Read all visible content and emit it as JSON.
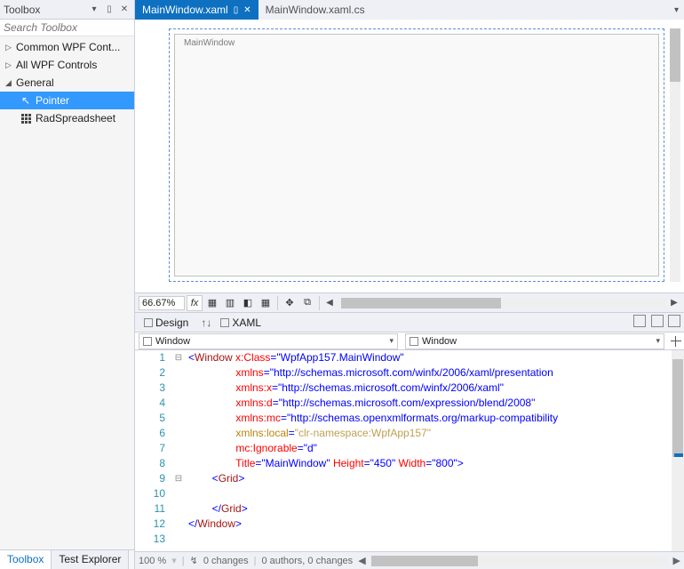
{
  "sidebar": {
    "title": "Toolbox",
    "search_placeholder": "Search Toolbox",
    "groups": {
      "g0": {
        "label": "Common WPF Cont..."
      },
      "g1": {
        "label": "All WPF Controls"
      },
      "g2": {
        "label": "General"
      }
    },
    "tools": {
      "pointer": "Pointer",
      "radspread": "RadSpreadsheet"
    },
    "tabs": {
      "toolbox": "Toolbox",
      "test_explorer": "Test Explorer"
    }
  },
  "tabs": {
    "active": "MainWindow.xaml",
    "inactive": "MainWindow.xaml.cs"
  },
  "designer": {
    "window_caption": "MainWindow",
    "zoom": "66.67%"
  },
  "panes": {
    "design": "Design",
    "xaml": "XAML"
  },
  "breadcrumb": {
    "left": "Window",
    "right": "Window"
  },
  "code": {
    "lines": [
      {
        "n": 1,
        "indent": 0,
        "kind": "open",
        "elem": "Window",
        "attrs": [
          {
            "n": "x:Class",
            "v": "\"WpfApp157.MainWindow\""
          }
        ]
      },
      {
        "n": 2,
        "indent": 2,
        "kind": "attr",
        "attrs": [
          {
            "n": "xmlns",
            "v": "\"http://schemas.microsoft.com/winfx/2006/xaml/presentation"
          }
        ]
      },
      {
        "n": 3,
        "indent": 2,
        "kind": "attr",
        "attrs": [
          {
            "n": "xmlns:x",
            "v": "\"http://schemas.microsoft.com/winfx/2006/xaml\""
          }
        ]
      },
      {
        "n": 4,
        "indent": 2,
        "kind": "attr",
        "attrs": [
          {
            "n": "xmlns:d",
            "v": "\"http://schemas.microsoft.com/expression/blend/2008\""
          }
        ]
      },
      {
        "n": 5,
        "indent": 2,
        "kind": "attr",
        "attrs": [
          {
            "n": "xmlns:mc",
            "v": "\"http://schemas.openxmlformats.org/markup-compatibility"
          }
        ]
      },
      {
        "n": 6,
        "indent": 2,
        "kind": "attr-dim",
        "attrs": [
          {
            "n": "xmlns:local",
            "v": "\"clr-namespace:WpfApp157\""
          }
        ]
      },
      {
        "n": 7,
        "indent": 2,
        "kind": "attr",
        "attrs": [
          {
            "n": "mc:Ignorable",
            "v": "\"d\""
          }
        ]
      },
      {
        "n": 8,
        "indent": 2,
        "kind": "attr-close",
        "attrs": [
          {
            "n": "Title",
            "v": "\"MainWindow\""
          },
          {
            "n": "Height",
            "v": "\"450\""
          },
          {
            "n": "Width",
            "v": "\"800\""
          }
        ]
      },
      {
        "n": 9,
        "indent": 1,
        "kind": "open-close",
        "elem": "Grid"
      },
      {
        "n": 10,
        "indent": 0,
        "kind": "blank"
      },
      {
        "n": 11,
        "indent": 1,
        "kind": "close",
        "elem": "Grid"
      },
      {
        "n": 12,
        "indent": 0,
        "kind": "close",
        "elem": "Window"
      },
      {
        "n": 13,
        "indent": 0,
        "kind": "blank"
      }
    ]
  },
  "footer": {
    "zoom": "100 %",
    "changes": "0 changes",
    "authors": "0 authors, 0 changes"
  }
}
